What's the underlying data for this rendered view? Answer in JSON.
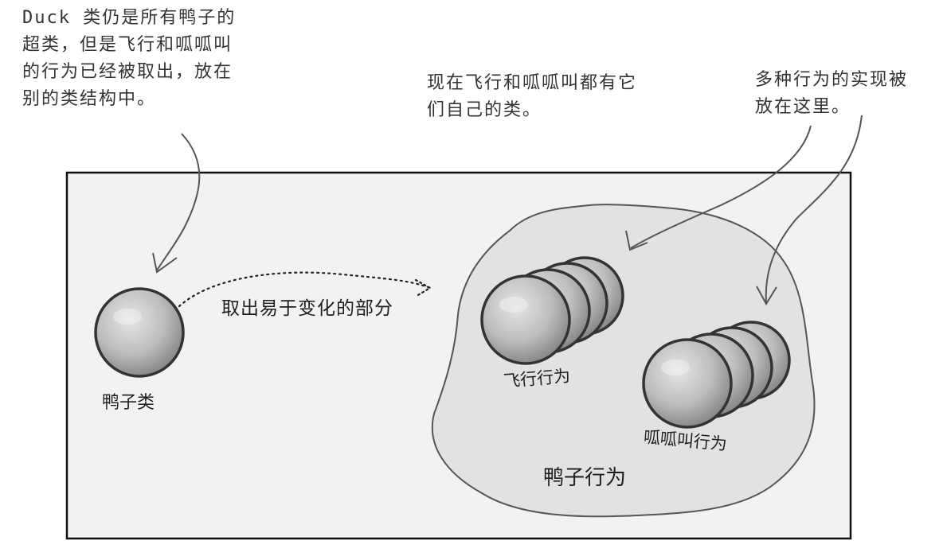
{
  "annotations": {
    "superclass_note": [
      "Duck 类仍是所有鸭子的",
      "超类，但是飞行和呱呱叫",
      "的行为已经被取出，放在",
      "别的类结构中。"
    ],
    "own_classes_note": [
      "现在飞行和呱呱叫都有它",
      "们自己的类。"
    ],
    "implementations_note": [
      "多种行为的实现被",
      "放在这里。"
    ]
  },
  "labels": {
    "duck_class": "鸭子类",
    "extract_arrow": "取出易于变化的部分",
    "fly_behavior": "飞行行为",
    "quack_behavior": "呱呱叫行为",
    "duck_behaviors": "鸭子行为"
  },
  "colors": {
    "box_fill": "#f2f2f2",
    "blob_fill": "#e2e2e2",
    "sphere_outline": "#333333",
    "sphere_light": "#e6e6e6",
    "sphere_dark": "#8a8a8a"
  }
}
